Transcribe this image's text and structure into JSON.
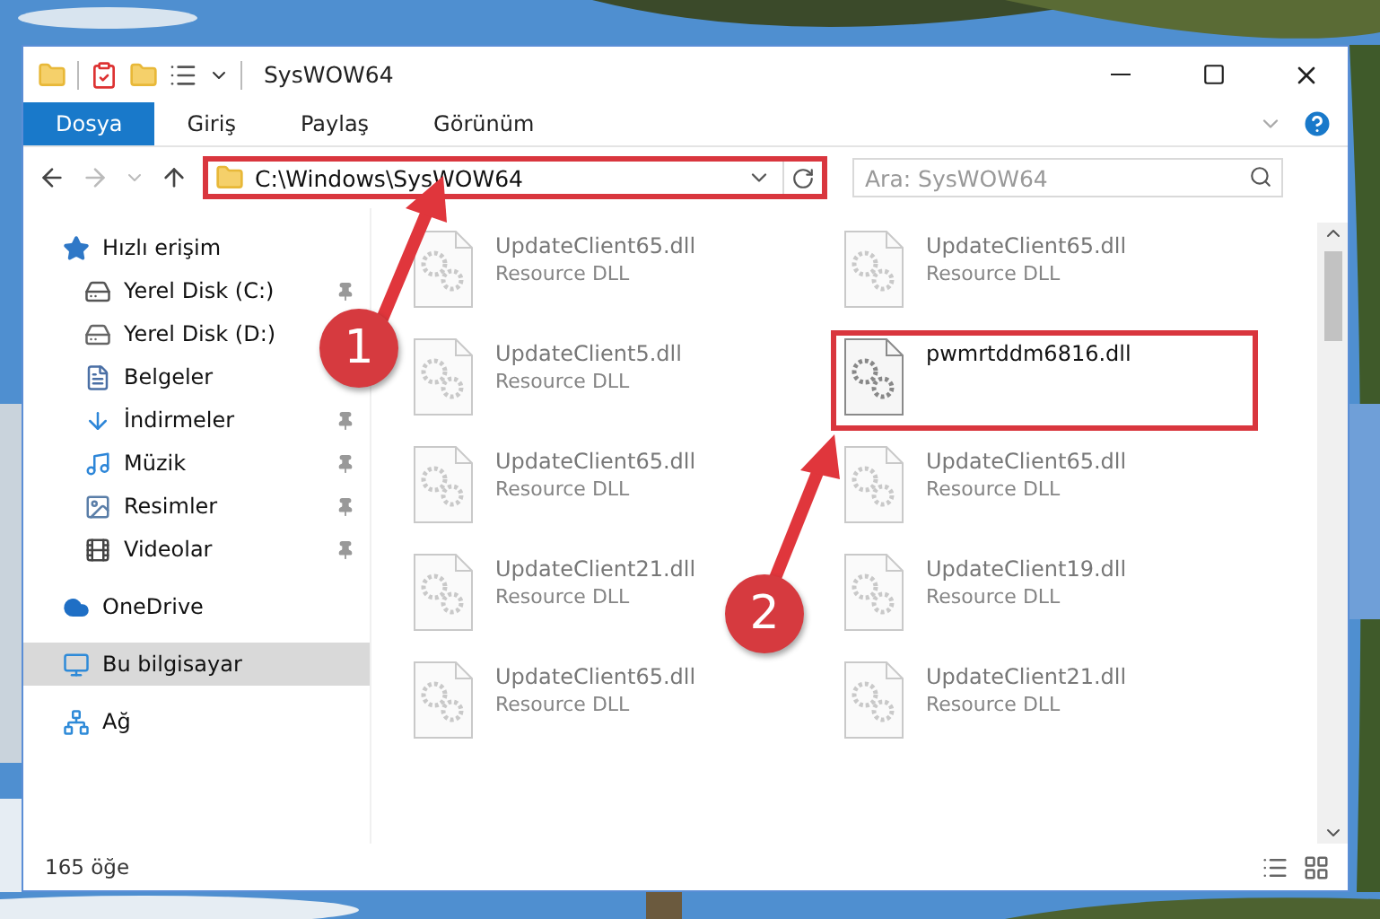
{
  "window": {
    "title": "SysWOW64"
  },
  "ribbon": {
    "tabs": [
      {
        "label": "Dosya",
        "selected": true
      },
      {
        "label": "Giriş",
        "selected": false
      },
      {
        "label": "Paylaş",
        "selected": false
      },
      {
        "label": "Görünüm",
        "selected": false
      }
    ]
  },
  "address_bar": {
    "path": "C:\\Windows\\SysWOW64",
    "highlighted": true
  },
  "search": {
    "placeholder": "Ara: SysWOW64"
  },
  "sidebar": {
    "items": [
      {
        "label": "Hızlı erişim",
        "kind": "star",
        "selected": false,
        "children": [
          {
            "label": "Yerel Disk (C:)",
            "kind": "drive-windows",
            "pinned": true
          },
          {
            "label": "Yerel Disk (D:)",
            "kind": "drive",
            "pinned": false
          },
          {
            "label": "Belgeler",
            "kind": "documents",
            "pinned": false
          },
          {
            "label": "İndirmeler",
            "kind": "downloads",
            "pinned": true
          },
          {
            "label": "Müzik",
            "kind": "music",
            "pinned": true
          },
          {
            "label": "Resimler",
            "kind": "pictures",
            "pinned": true
          },
          {
            "label": "Videolar",
            "kind": "videos",
            "pinned": true
          }
        ]
      },
      {
        "label": "OneDrive",
        "kind": "cloud",
        "selected": false
      },
      {
        "label": "Bu bilgisayar",
        "kind": "computer",
        "selected": true
      },
      {
        "label": "Ağ",
        "kind": "network",
        "selected": false
      }
    ]
  },
  "files": [
    {
      "name": "UpdateClient65.dll",
      "type": "Resource DLL",
      "faded": true,
      "highlighted": false
    },
    {
      "name": "UpdateClient65.dll",
      "type": "Resource DLL",
      "faded": true,
      "highlighted": false
    },
    {
      "name": "UpdateClient5.dll",
      "type": "Resource DLL",
      "faded": true,
      "highlighted": false
    },
    {
      "name": "pwmrtddm6816.dll",
      "faded": false,
      "highlighted": true
    },
    {
      "name": "UpdateClient65.dll",
      "type": "Resource DLL",
      "faded": true,
      "highlighted": false
    },
    {
      "name": "UpdateClient65.dll",
      "type": "Resource DLL",
      "faded": true,
      "highlighted": false
    },
    {
      "name": "UpdateClient21.dll",
      "type": "Resource DLL",
      "faded": true,
      "highlighted": false
    },
    {
      "name": "UpdateClient19.dll",
      "type": "Resource DLL",
      "faded": true,
      "highlighted": false
    },
    {
      "name": "UpdateClient65.dll",
      "type": "Resource DLL",
      "faded": true,
      "highlighted": false
    },
    {
      "name": "UpdateClient21.dll",
      "type": "Resource DLL",
      "faded": true,
      "highlighted": false
    }
  ],
  "status_bar": {
    "count": "165 öğe"
  },
  "annotations": [
    {
      "number": "1"
    },
    {
      "number": "2"
    }
  ]
}
